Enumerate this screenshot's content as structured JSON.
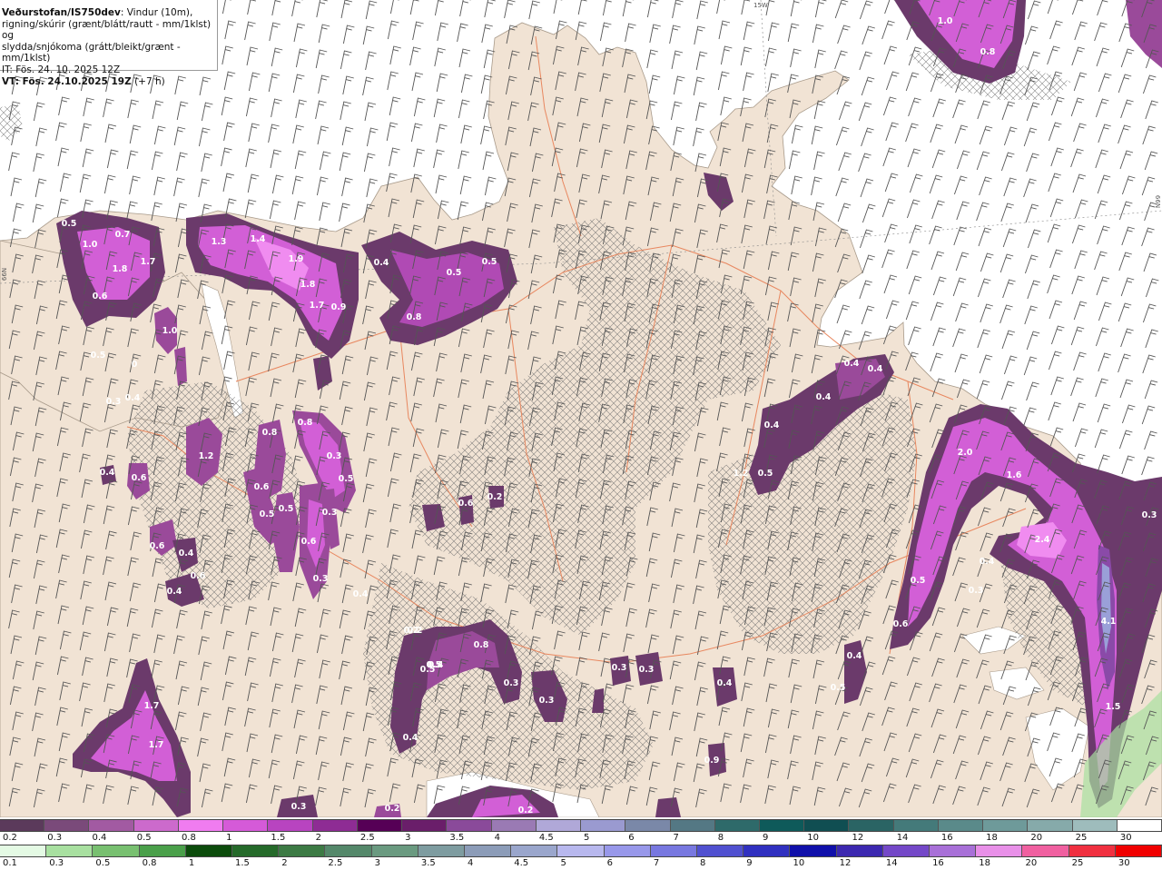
{
  "info": {
    "model": "Veðurstofan/IS750dev",
    "line1_rest": ": Vindur (10m),",
    "line2": "rigning/skúrir (grænt/blátt/rautt - mm/1klst) og",
    "line3": "slydda/snjókoma (grátt/bleikt/grænt - mm/1klst)",
    "it": "IT: Fös. 24. 10. 2025 12Z",
    "vt_label": "VT: Fös. 24.10.2025 19Z",
    "vt_offset": " (+7 h)"
  },
  "grid_labels": {
    "top": "15W",
    "right": "66N",
    "left": "66N"
  },
  "colors": {
    "sea": "#ffffff",
    "land": "#f1e3d4",
    "road": "#e8875f",
    "barb": "#555555",
    "precip_light": "#6b3a6b",
    "precip_mid": "#9a4a9a",
    "precip_strong": "#d25fd6",
    "precip_peak": "#f08cf0"
  },
  "legend_snow": {
    "labels": [
      "0.2",
      "0.3",
      "0.4",
      "0.5",
      "0.8",
      "1",
      "1.5",
      "2",
      "2.5",
      "3",
      "3.5",
      "4",
      "4.5",
      "5",
      "6",
      "7",
      "8",
      "9",
      "10",
      "12",
      "14",
      "16",
      "18",
      "20",
      "25",
      "30"
    ],
    "colors": [
      "#5b3a5b",
      "#7a4a7a",
      "#a25aa2",
      "#cc6acc",
      "#f07cf0",
      "#d55ad8",
      "#b844c0",
      "#8e2c94",
      "#560056",
      "#6a1e6a",
      "#8a4a9a",
      "#9a7ab4",
      "#b0a8d8",
      "#9a9ad0",
      "#7a88a8",
      "#547884",
      "#2e6a6a",
      "#0e5a5a",
      "#104e52",
      "#2a6464",
      "#447a7a",
      "#5a8a8a",
      "#6e9a9a",
      "#86aaaa",
      "#9ebcbc",
      "#ffffff"
    ]
  },
  "legend_rain": {
    "labels": [
      "0.1",
      "0.3",
      "0.5",
      "0.8",
      "1",
      "1.5",
      "2",
      "2.5",
      "3",
      "3.5",
      "4",
      "4.5",
      "5",
      "6",
      "7",
      "8",
      "9",
      "10",
      "12",
      "14",
      "16",
      "18",
      "20",
      "25",
      "30"
    ],
    "colors": [
      "#e4fae4",
      "#a8e0a0",
      "#78c070",
      "#4aa04a",
      "#0c4c0c",
      "#256a2a",
      "#3c7a44",
      "#54886a",
      "#6a9a80",
      "#7e9ca0",
      "#8c9cb8",
      "#9aa6cc",
      "#b8b8ee",
      "#9898ea",
      "#7878e0",
      "#5050d0",
      "#3030c0",
      "#1010aa",
      "#3c28b0",
      "#7448c8",
      "#a870d8",
      "#e890e8",
      "#f060a0",
      "#f03040",
      "#f00000"
    ]
  },
  "precip_values": [
    {
      "v": "0.5"
    },
    {
      "v": "1.0"
    },
    {
      "v": "0.7"
    },
    {
      "v": "1.8"
    },
    {
      "v": "1.7"
    },
    {
      "v": "0.6"
    },
    {
      "v": "1.3"
    },
    {
      "v": "1.4"
    },
    {
      "v": "1.9"
    },
    {
      "v": "1.8"
    },
    {
      "v": "1.7"
    },
    {
      "v": "0.9"
    },
    {
      "v": "0.4"
    },
    {
      "v": "0.5"
    },
    {
      "v": "0.5"
    },
    {
      "v": "0.8"
    },
    {
      "v": "1.0"
    },
    {
      "v": "0.5"
    },
    {
      "v": "0"
    },
    {
      "v": "0.3"
    },
    {
      "v": "0.4"
    },
    {
      "v": "0.8"
    },
    {
      "v": "0.8"
    },
    {
      "v": "1.2"
    },
    {
      "v": "0.3"
    },
    {
      "v": "0.5"
    },
    {
      "v": "0.6"
    },
    {
      "v": "0.4"
    },
    {
      "v": "0.6"
    },
    {
      "v": "0.5"
    },
    {
      "v": "0.5"
    },
    {
      "v": "0.6"
    },
    {
      "v": "0.6"
    },
    {
      "v": "0.3"
    },
    {
      "v": "0.6"
    },
    {
      "v": "0.4"
    },
    {
      "v": "0.3"
    },
    {
      "v": "0.4"
    },
    {
      "v": "0.6"
    },
    {
      "v": "0.2"
    },
    {
      "v": "0.2"
    },
    {
      "v": "0.4"
    },
    {
      "v": "0.4"
    },
    {
      "v": "0.5"
    },
    {
      "v": "0.5"
    },
    {
      "v": "0.4"
    },
    {
      "v": "1.2"
    },
    {
      "v": "0.5"
    },
    {
      "v": "0.2"
    },
    {
      "v": "0.5"
    },
    {
      "v": "0.8"
    },
    {
      "v": "0.3"
    },
    {
      "v": "0.3"
    },
    {
      "v": "0.4"
    },
    {
      "v": "0.3"
    },
    {
      "v": "0.3"
    },
    {
      "v": "0.4"
    },
    {
      "v": "0.4"
    },
    {
      "v": "0.4"
    },
    {
      "v": "1.0"
    },
    {
      "v": "0.8"
    },
    {
      "v": "2.0"
    },
    {
      "v": "1.6"
    },
    {
      "v": "2.4"
    },
    {
      "v": "0.4"
    },
    {
      "v": "0.5"
    },
    {
      "v": "0.3"
    },
    {
      "v": "0.6"
    },
    {
      "v": "0.4"
    },
    {
      "v": "4.1"
    },
    {
      "v": "1.5"
    },
    {
      "v": "0.3"
    },
    {
      "v": "1.7"
    },
    {
      "v": "1.7"
    },
    {
      "v": "0.3"
    },
    {
      "v": "0.2"
    },
    {
      "v": "0.5"
    },
    {
      "v": "0.4"
    },
    {
      "v": "0.2"
    },
    {
      "v": "0.9"
    }
  ]
}
